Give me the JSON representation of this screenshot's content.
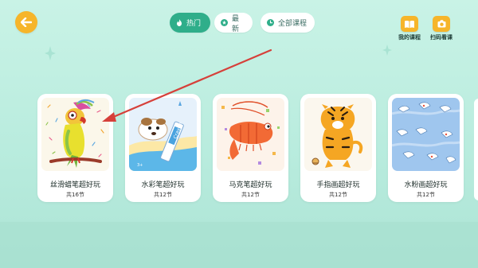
{
  "tabs": [
    {
      "label": "热门",
      "active": true,
      "icon": "flame-icon"
    },
    {
      "label": "最新",
      "active": false,
      "icon": "star-icon"
    },
    {
      "label": "全部课程",
      "active": false,
      "icon": "clock-icon"
    }
  ],
  "actions": {
    "my_courses": "我的课程",
    "scan": "扫码看课"
  },
  "courses": [
    {
      "title": "丝滑蜡笔超好玩",
      "count": "共16节",
      "art": "crayon-parrot-illustration"
    },
    {
      "title": "水彩笔超好玩",
      "count": "共12节",
      "art": "marker-dog-illustration"
    },
    {
      "title": "马克笔超好玩",
      "count": "共12节",
      "art": "shrimp-illustration"
    },
    {
      "title": "手指画超好玩",
      "count": "共12节",
      "art": "tiger-illustration"
    },
    {
      "title": "水粉画超好玩",
      "count": "共12节",
      "art": "gouache-birds-illustration"
    }
  ],
  "colors": {
    "accent": "#2fae8a",
    "button": "#f6b52a",
    "annotation_arrow": "#d6403a"
  }
}
